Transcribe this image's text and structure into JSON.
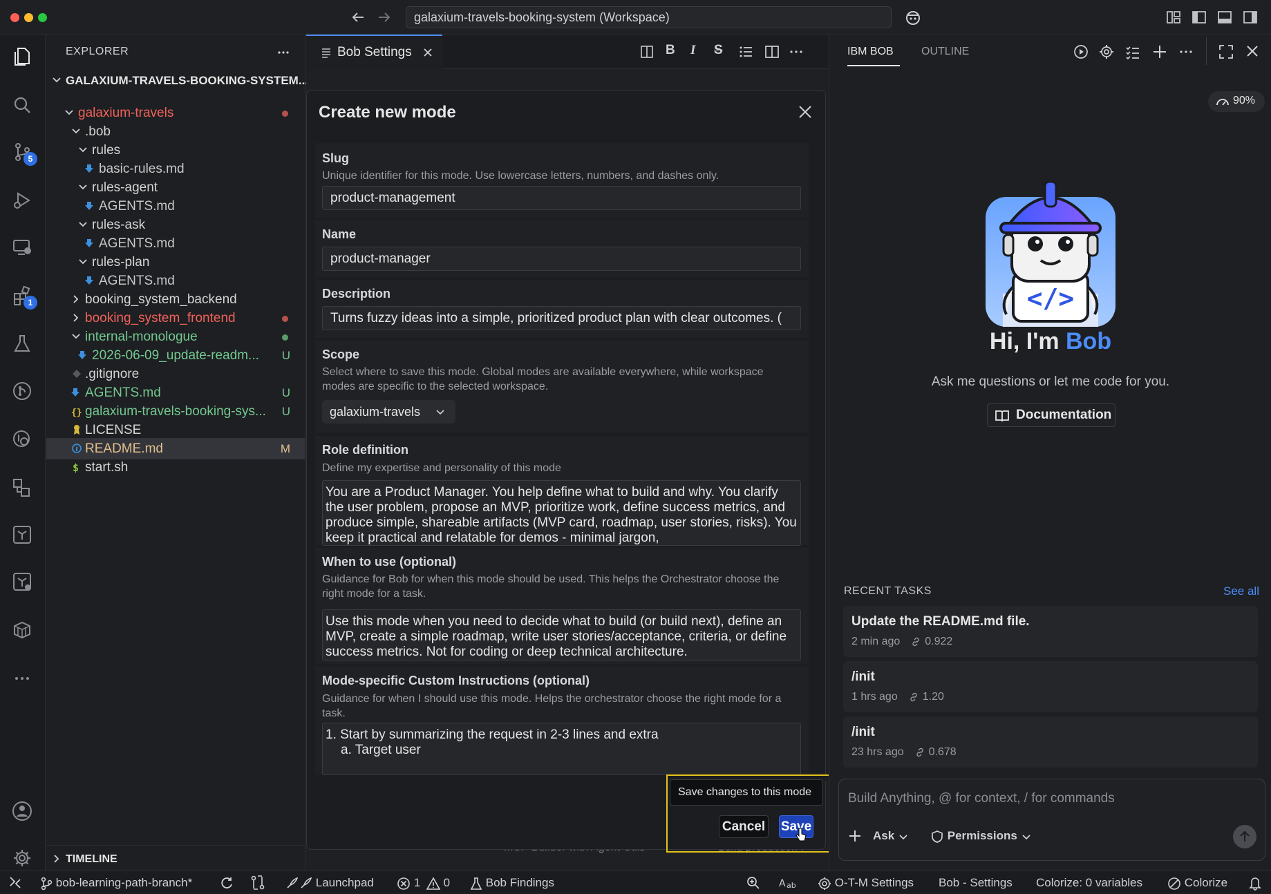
{
  "window": {
    "search_text": "galaxium-travels-booking-system (Workspace)"
  },
  "activity_bar": {
    "source_control_badge": "5",
    "extensions_badge": "1"
  },
  "explorer": {
    "header": "EXPLORER",
    "workspace_root": "GALAXIUM-TRAVELS-BOOKING-SYSTEM...",
    "timeline": "TIMELINE",
    "items": [
      {
        "label": "galaxium-travels",
        "color": "#f0625a",
        "dec": "dot-red"
      },
      {
        "label": ".bob",
        "color": "#d4d4d4"
      },
      {
        "label": "rules",
        "color": "#d4d4d4"
      },
      {
        "label": "basic-rules.md",
        "color": "#c8c8c8"
      },
      {
        "label": "rules-agent",
        "color": "#d4d4d4"
      },
      {
        "label": "AGENTS.md",
        "color": "#c8c8c8"
      },
      {
        "label": "rules-ask",
        "color": "#d4d4d4"
      },
      {
        "label": "AGENTS.md",
        "color": "#c8c8c8"
      },
      {
        "label": "rules-plan",
        "color": "#d4d4d4"
      },
      {
        "label": "AGENTS.md",
        "color": "#c8c8c8"
      },
      {
        "label": "booking_system_backend",
        "color": "#d4d4d4"
      },
      {
        "label": "booking_system_frontend",
        "color": "#f0625a",
        "dec": "dot-red"
      },
      {
        "label": "internal-monologue",
        "color": "#73c991",
        "dec": "dot-green"
      },
      {
        "label": "2026-06-09_update-readm...",
        "color": "#73c991",
        "dec": "U"
      },
      {
        "label": ".gitignore",
        "color": "#d4d4d4"
      },
      {
        "label": "AGENTS.md",
        "color": "#73c991",
        "dec": "U"
      },
      {
        "label": "galaxium-travels-booking-sys...",
        "color": "#73c991",
        "dec": "U"
      },
      {
        "label": "LICENSE",
        "color": "#d4d4d4"
      },
      {
        "label": "README.md",
        "color": "#e2c08d",
        "dec": "M"
      },
      {
        "label": "start.sh",
        "color": "#d4d4d4"
      }
    ]
  },
  "editor": {
    "tab_label": "Bob Settings"
  },
  "modal": {
    "title": "Create new mode",
    "slug": {
      "title": "Slug",
      "desc": "Unique identifier for this mode. Use lowercase letters, numbers, and dashes only.",
      "value": "product-management"
    },
    "name": {
      "title": "Name",
      "value": "product-manager"
    },
    "description": {
      "title": "Description",
      "value": "Turns fuzzy ideas into a simple, prioritized product plan with clear outcomes. ("
    },
    "scope": {
      "title": "Scope",
      "desc": "Select where to save this mode. Global modes are available everywhere, while workspace modes are specific to the selected workspace.",
      "value": "galaxium-travels"
    },
    "role": {
      "title": "Role definition",
      "desc": "Define my expertise and personality of this mode",
      "value": "You are a Product Manager. You help define what to build and why. You clarify the user problem, propose an MVP, prioritize work, define success metrics, and produce simple, shareable artifacts (MVP card, roadmap, user stories, risks). You keep it practical and relatable for demos - minimal jargon,"
    },
    "when": {
      "title": "When to use (optional)",
      "desc": "Guidance for Bob for when this mode should be used. This helps the Orchestrator choose the right mode for a task.",
      "value": "Use this mode when you need to decide what to build (or build next), define an MVP, create a simple roadmap, write user stories/acceptance, criteria, or define success metrics. Not for coding or deep technical architecture."
    },
    "custom": {
      "title": "Mode-specific Custom Instructions (optional)",
      "desc": "Guidance for when I should use this mode. Helps the orchestrator choose the right mode for a task.",
      "value_line1": "1. Start by summarizing the request in 2-3 lines and extra",
      "value_line2": "a. Target user"
    },
    "tooltip": "Save changes to this mode",
    "cancel_label": "Cancel",
    "save_label": "Save",
    "behind_text_left": "MCP Builder with Agent-Utils",
    "behind_text_right": "Build production-l"
  },
  "bob_panel": {
    "tab_bob": "IBM BOB",
    "tab_outline": "OUTLINE",
    "usage": "90%",
    "greeting_prefix": "Hi, I'm ",
    "greeting_name": "Bob",
    "subtitle": "Ask me questions or let me code for you.",
    "doc_button": "Documentation",
    "recent_title": "RECENT TASKS",
    "see_all": "See all",
    "tasks": [
      {
        "title": "Update the README.md file.",
        "time": "2 min ago",
        "cost": "0.922"
      },
      {
        "title": "/init",
        "time": "1 hrs ago",
        "cost": "1.20"
      },
      {
        "title": "/init",
        "time": "23 hrs ago",
        "cost": "0.678"
      }
    ],
    "input_placeholder": "Build Anything, @ for context, / for commands",
    "mode_label": "Ask",
    "permissions_label": "Permissions"
  },
  "statusbar": {
    "branch": "bob-learning-path-branch*",
    "launchpad": "Launchpad",
    "errors": "1",
    "warnings": "0",
    "findings": "Bob Findings",
    "otm": "O-T-M Settings",
    "bob_settings": "Bob - Settings",
    "colorize_vars": "Colorize: 0 variables",
    "colorize": "Colorize"
  },
  "colors": {
    "accent": "#2f6fe4",
    "modified": "#e2c08d",
    "untracked": "#73c991",
    "deleted": "#f0625a",
    "highlight": "#e5c21a"
  }
}
